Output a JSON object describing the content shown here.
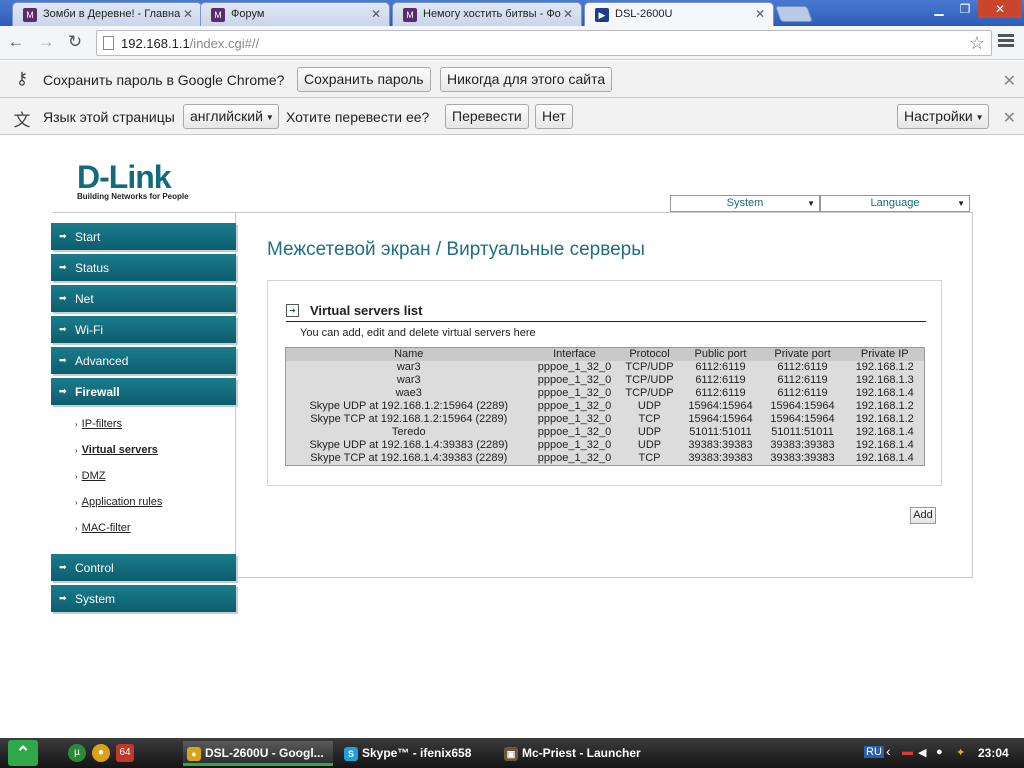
{
  "browser": {
    "tabs": [
      {
        "title": "Зомби в Деревне! - Главна"
      },
      {
        "title": "Форум"
      },
      {
        "title": "Немогу хостить битвы - Фо"
      },
      {
        "title": "DSL-2600U"
      }
    ],
    "url_host": "192.168.1.1",
    "url_rest": "/index.cgi#//"
  },
  "password_bar": {
    "text": "Сохранить пароль в Google Chrome?",
    "save_label": "Сохранить пароль",
    "never_label": "Никогда для этого сайта"
  },
  "translate_bar": {
    "text_before": "Язык этой страницы",
    "language": "английский",
    "question": "Хотите перевести ее?",
    "translate_label": "Перевести",
    "no_label": "Нет",
    "settings_label": "Настройки"
  },
  "dlink": {
    "brand": "D-Link",
    "tagline": "Building Networks for People",
    "system_select": "System",
    "language_select": "Language",
    "nav": {
      "start": "Start",
      "status": "Status",
      "net": "Net",
      "wifi": "Wi-Fi",
      "advanced": "Advanced",
      "firewall": "Firewall",
      "control": "Control",
      "system": "System"
    },
    "firewall_sub": {
      "ip_filters": "IP-filters",
      "virtual_servers": "Virtual servers",
      "dmz": "DMZ",
      "application_rules": "Application rules",
      "mac_filter": "MAC-filter"
    },
    "page_title": "Межсетевой экран / Виртуальные серверы",
    "panel_title": "Virtual servers list",
    "panel_desc": "You can add, edit and delete virtual servers here",
    "add_label": "Add",
    "table": {
      "headers": {
        "name": "Name",
        "interface": "Interface",
        "protocol": "Protocol",
        "public_port": "Public port",
        "private_port": "Private port",
        "private_ip": "Private IP"
      },
      "rows": [
        {
          "name": "war3",
          "interface": "pppoe_1_32_0",
          "protocol": "TCP/UDP",
          "public_port": "6112:6119",
          "private_port": "6112:6119",
          "private_ip": "192.168.1.2"
        },
        {
          "name": "war3",
          "interface": "pppoe_1_32_0",
          "protocol": "TCP/UDP",
          "public_port": "6112:6119",
          "private_port": "6112:6119",
          "private_ip": "192.168.1.3"
        },
        {
          "name": "wae3",
          "interface": "pppoe_1_32_0",
          "protocol": "TCP/UDP",
          "public_port": "6112:6119",
          "private_port": "6112:6119",
          "private_ip": "192.168.1.4"
        },
        {
          "name": "Skype UDP at 192.168.1.2:15964 (2289)",
          "interface": "pppoe_1_32_0",
          "protocol": "UDP",
          "public_port": "15964:15964",
          "private_port": "15964:15964",
          "private_ip": "192.168.1.2"
        },
        {
          "name": "Skype TCP at 192.168.1.2:15964 (2289)",
          "interface": "pppoe_1_32_0",
          "protocol": "TCP",
          "public_port": "15964:15964",
          "private_port": "15964:15964",
          "private_ip": "192.168.1.2"
        },
        {
          "name": "Teredo",
          "interface": "pppoe_1_32_0",
          "protocol": "UDP",
          "public_port": "51011:51011",
          "private_port": "51011:51011",
          "private_ip": "192.168.1.4"
        },
        {
          "name": "Skype UDP at 192.168.1.4:39383 (2289)",
          "interface": "pppoe_1_32_0",
          "protocol": "UDP",
          "public_port": "39383:39383",
          "private_port": "39383:39383",
          "private_ip": "192.168.1.4"
        },
        {
          "name": "Skype TCP at 192.168.1.4:39383 (2289)",
          "interface": "pppoe_1_32_0",
          "protocol": "TCP",
          "public_port": "39383:39383",
          "private_port": "39383:39383",
          "private_ip": "192.168.1.4"
        }
      ]
    }
  },
  "taskbar": {
    "badge": "64",
    "tasks": [
      {
        "label": "DSL-2600U - Googl..."
      },
      {
        "label": "Skype™ - ifenix658"
      },
      {
        "label": "Mc-Priest - Launcher"
      }
    ],
    "lang": "RU",
    "clock": "23:04"
  }
}
